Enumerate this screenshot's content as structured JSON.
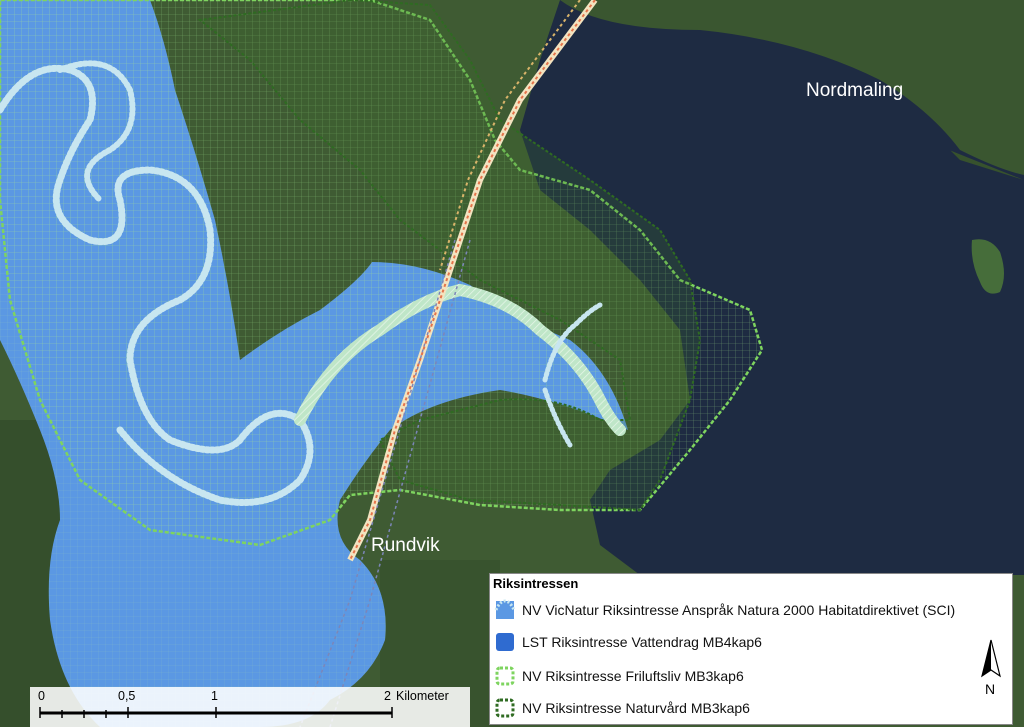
{
  "map": {
    "places": [
      {
        "name": "Nordmaling"
      },
      {
        "name": "Rundvik"
      }
    ],
    "colors": {
      "sea": "#1d2a40",
      "land": "#3c5a32",
      "river_zone": "#5b98e3",
      "friluftsliv": "#7ed45f",
      "naturvard": "#2f6b22",
      "natura2000": "#c8e6f0"
    }
  },
  "legend": {
    "title": "Riksintressen",
    "items": [
      {
        "label": "NV VicNatur Riksintresse Anspråk Natura 2000 Habitatdirektivet (SCI)",
        "icon": "natura2000-swatch-icon"
      },
      {
        "label": "LST Riksintresse Vattendrag MB4kap6",
        "icon": "vattendrag-swatch-icon"
      },
      {
        "label": "NV Riksintresse Friluftsliv MB3kap6",
        "icon": "friluftsliv-swatch-icon"
      },
      {
        "label": "NV Riksintresse Naturvård MB3kap6",
        "icon": "naturvard-swatch-icon"
      }
    ]
  },
  "scalebar": {
    "ticks": [
      "0",
      "0,5",
      "1",
      "2"
    ],
    "unit": "Kilometer"
  },
  "north_arrow": {
    "label": "N"
  }
}
